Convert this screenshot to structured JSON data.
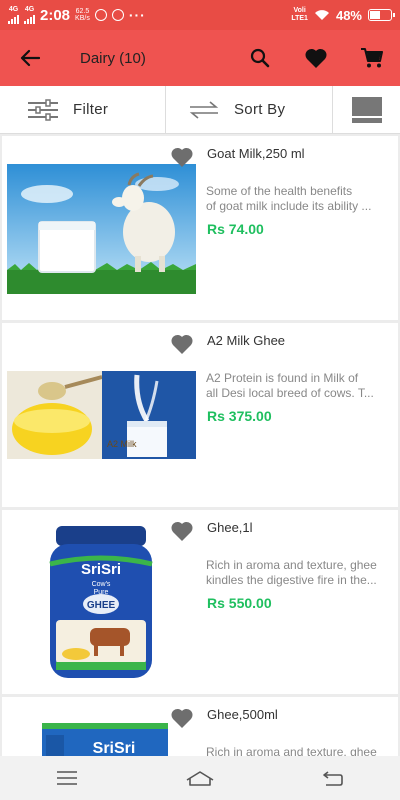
{
  "status_bar": {
    "net1": "4G",
    "net2": "4G",
    "time": "2:08",
    "speed_value": "62.5",
    "speed_unit": "KB/s",
    "volte1": "Voli",
    "volte2": "LTE1",
    "battery": "48%",
    "battery_level": 0.48
  },
  "app_bar": {
    "title": "Dairy (10)"
  },
  "filter_bar": {
    "filter_label": "Filter",
    "sort_label": "Sort By"
  },
  "products": [
    {
      "name": "Goat Milk,250 ml",
      "desc_line1": "Some of the health benefits",
      "desc_line2": "of goat milk include its ability ...",
      "price": "Rs 74.00"
    },
    {
      "name": "A2 Milk Ghee",
      "desc_line1": "A2 Protein is found in Milk of",
      "desc_line2": "all Desi local breed of cows. T...",
      "price": "Rs 375.00"
    },
    {
      "name": "Ghee,1l",
      "desc_line1": "Rich in aroma and texture, ghee",
      "desc_line2": "kindles the digestive fire in the...",
      "price": "Rs 550.00"
    },
    {
      "name": "Ghee,500ml",
      "desc_line1": "Rich in aroma and texture, ghee",
      "desc_line2": "",
      "price": ""
    }
  ],
  "image_text": {
    "a2_label": "A2 Milk",
    "brand": "SriSri",
    "jar_line1": "Cow's",
    "jar_line2": "Pure",
    "jar_label": "GHEE"
  },
  "colors": {
    "status_bar": "#e84c45",
    "app_bar": "#ef5350",
    "price": "#1fbf5f",
    "heart": "#6e6e6e"
  }
}
